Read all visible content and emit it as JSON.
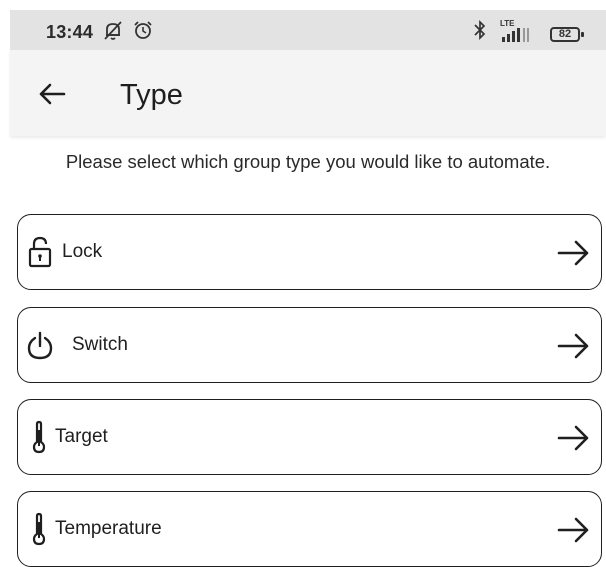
{
  "status_bar": {
    "time": "13:44",
    "battery_level": "82",
    "network_label": "LTE",
    "icons": [
      "notifications-off-icon",
      "alarm-icon",
      "bluetooth-icon",
      "lte-signal-icon",
      "battery-icon"
    ]
  },
  "app_bar": {
    "title": "Type",
    "back_icon": "arrow-left-icon"
  },
  "instruction": "Please select which group type you would like to automate.",
  "options": [
    {
      "label": "Lock",
      "icon": "lock-icon",
      "action_icon": "arrow-right-icon"
    },
    {
      "label": "Switch",
      "icon": "power-icon",
      "action_icon": "arrow-right-icon"
    },
    {
      "label": "Target",
      "icon": "thermometer-icon",
      "action_icon": "arrow-right-icon"
    },
    {
      "label": "Temperature",
      "icon": "thermometer-icon",
      "action_icon": "arrow-right-icon"
    }
  ],
  "colors": {
    "status_bar_bg": "#e3e3e3",
    "app_bar_bg": "#f4f4f4",
    "text": "#1f1f1f",
    "border": "#1f1f1f"
  }
}
